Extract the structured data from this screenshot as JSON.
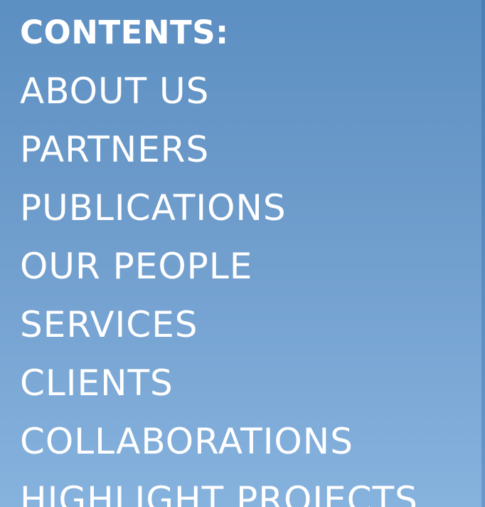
{
  "contents": {
    "title": "CONTENTS:",
    "items": [
      "ABOUT US",
      "PARTNERS",
      "PUBLICATIONS",
      "OUR PEOPLE",
      "SERVICES",
      "CLIENTS",
      "COLLABORATIONS",
      "HIGHLIGHT PROJECTS"
    ]
  },
  "colors": {
    "background_top": "#5c8fc2",
    "background_bottom": "#86b2de",
    "text": "#ffffff"
  }
}
